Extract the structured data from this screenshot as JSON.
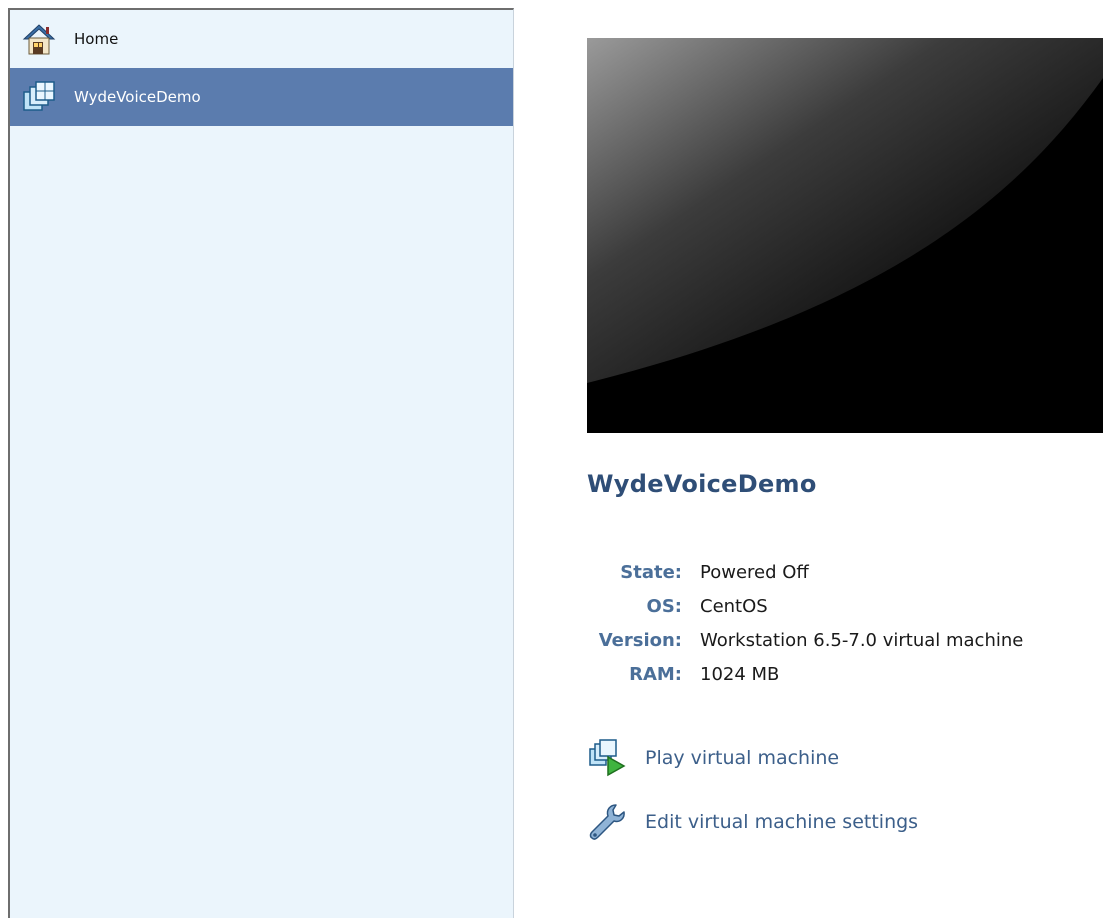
{
  "sidebar": {
    "items": [
      {
        "label": "Home",
        "icon": "home-icon",
        "selected": false
      },
      {
        "label": "WydeVoiceDemo",
        "icon": "virtual-machine-icon",
        "selected": true
      }
    ],
    "selected_color": "#5b7cae",
    "background_color": "#ebf5fc"
  },
  "vm": {
    "name": "WydeVoiceDemo",
    "details": [
      {
        "key": "State:",
        "value": "Powered Off"
      },
      {
        "key": "OS:",
        "value": "CentOS"
      },
      {
        "key": "Version:",
        "value": "Workstation 6.5-7.0 virtual machine"
      },
      {
        "key": "RAM:",
        "value": "1024 MB"
      }
    ]
  },
  "actions": {
    "play": {
      "label": "Play virtual machine",
      "icon": "play-vm-icon"
    },
    "edit": {
      "label": "Edit virtual machine settings",
      "icon": "wrench-icon"
    }
  },
  "colors": {
    "title": "#2f4e77",
    "detail_key": "#4b6f99",
    "action_link": "#3c5f8a"
  }
}
